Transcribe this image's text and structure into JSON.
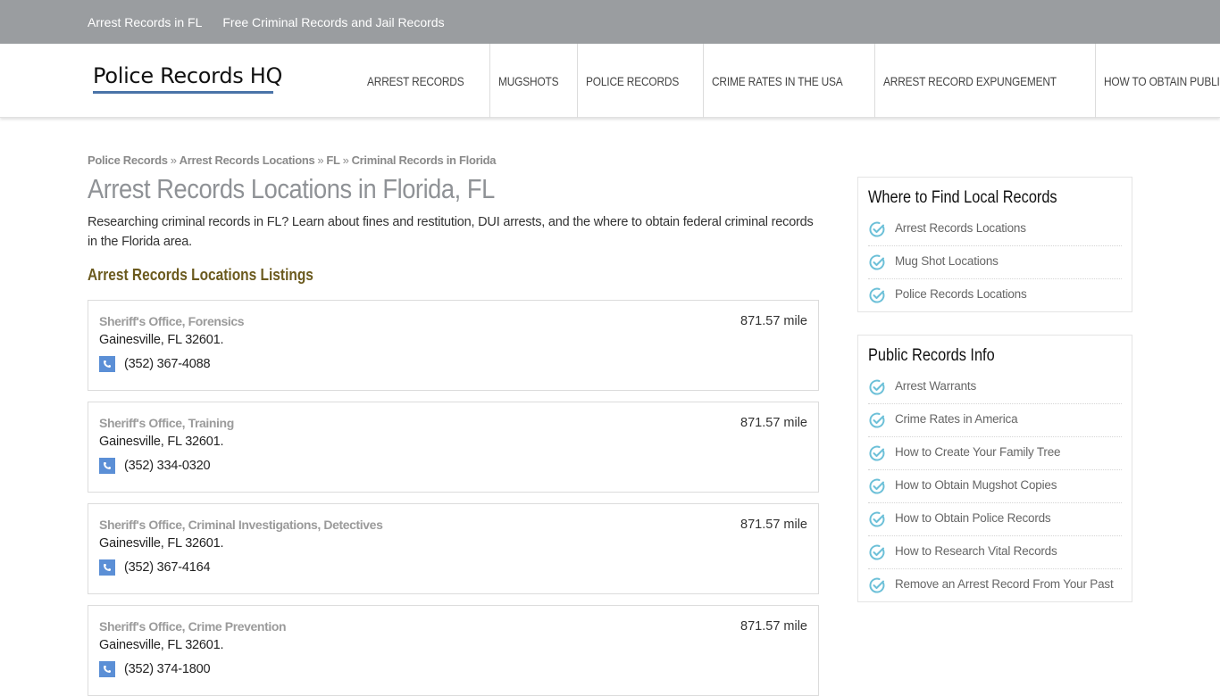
{
  "topbar": {
    "links": [
      "Arrest Records in FL",
      "Free Criminal Records and Jail Records"
    ]
  },
  "header": {
    "logo": "Police Records HQ",
    "nav": [
      "ARREST RECORDS",
      "MUGSHOTS",
      "POLICE RECORDS",
      "CRIME RATES IN THE USA",
      "ARREST RECORD EXPUNGEMENT",
      "HOW TO OBTAIN PUBLIC RECORDS"
    ]
  },
  "breadcrumb": {
    "items": [
      "Police Records",
      "Arrest Records Locations",
      "FL",
      "Criminal Records in Florida"
    ],
    "separator": "»"
  },
  "main": {
    "title": "Arrest Records Locations in Florida, FL",
    "intro": "Researching criminal records in FL? Learn about fines and restitution, DUI arrests, and the where to obtain federal criminal records in the Florida area.",
    "listings_title": "Arrest Records Locations Listings",
    "listings": [
      {
        "name": "Sheriff's Office, Forensics",
        "address": "Gainesville, FL 32601.",
        "phone": "(352) 367-4088",
        "distance": "871.57 mile"
      },
      {
        "name": "Sheriff's Office, Training",
        "address": "Gainesville, FL 32601.",
        "phone": "(352) 334-0320",
        "distance": "871.57 mile"
      },
      {
        "name": "Sheriff's Office, Criminal Investigations, Detectives",
        "address": "Gainesville, FL 32601.",
        "phone": "(352) 367-4164",
        "distance": "871.57 mile"
      },
      {
        "name": "Sheriff's Office, Crime Prevention",
        "address": "Gainesville, FL 32601.",
        "phone": "(352) 374-1800",
        "distance": "871.57 mile"
      }
    ]
  },
  "sidebar": {
    "local": {
      "title": "Where to Find Local Records",
      "items": [
        "Arrest Records Locations",
        "Mug Shot Locations",
        "Police Records Locations"
      ]
    },
    "info": {
      "title": "Public Records Info",
      "items": [
        "Arrest Warrants",
        "Crime Rates in America",
        "How to Create Your Family Tree",
        "How to Obtain Mugshot Copies",
        "How to Obtain Police Records",
        "How to Research Vital Records",
        "Remove an Arrest Record From Your Past"
      ]
    }
  },
  "colors": {
    "topbar_bg": "#9a9da0",
    "logo_underline": "#4a74a8",
    "phone_icon": "#5b8fd6",
    "check_icon": "#6cc0d8",
    "section_title": "#6b5a1e"
  }
}
